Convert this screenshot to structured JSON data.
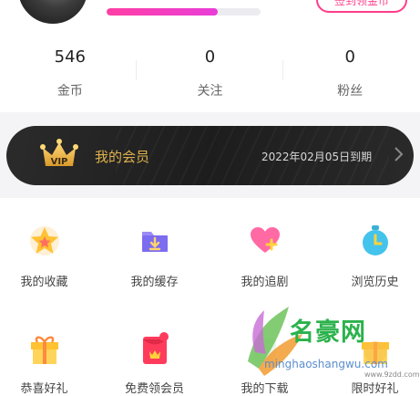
{
  "profile": {
    "signin_label": "签到领金币",
    "progress_fraction": 0.72
  },
  "stats": [
    {
      "value": "546",
      "label": "金币"
    },
    {
      "value": "0",
      "label": "关注"
    },
    {
      "value": "0",
      "label": "粉丝"
    }
  ],
  "vip": {
    "badge_text": "VIP",
    "title": "我的会员",
    "expiry": "2022年02月05日到期",
    "accent_color": "#e0b24d"
  },
  "grid": {
    "row1": [
      {
        "label": "我的收藏",
        "icon": "star-icon"
      },
      {
        "label": "我的缓存",
        "icon": "download-folder-icon"
      },
      {
        "label": "我的追剧",
        "icon": "heart-plus-icon"
      },
      {
        "label": "浏览历史",
        "icon": "clock-icon"
      }
    ],
    "row2": [
      {
        "label": "恭喜好礼",
        "icon": "gift-icon"
      },
      {
        "label": "免费领会员",
        "icon": "red-envelope-icon"
      },
      {
        "label": "我的下载",
        "icon": "leaf-icon"
      },
      {
        "label": "限时好礼",
        "icon": "gift-icon"
      }
    ]
  },
  "watermark": {
    "text": "名豪网",
    "url": "minghaoshangwu.com",
    "url_small": "www.9zdd.com"
  }
}
